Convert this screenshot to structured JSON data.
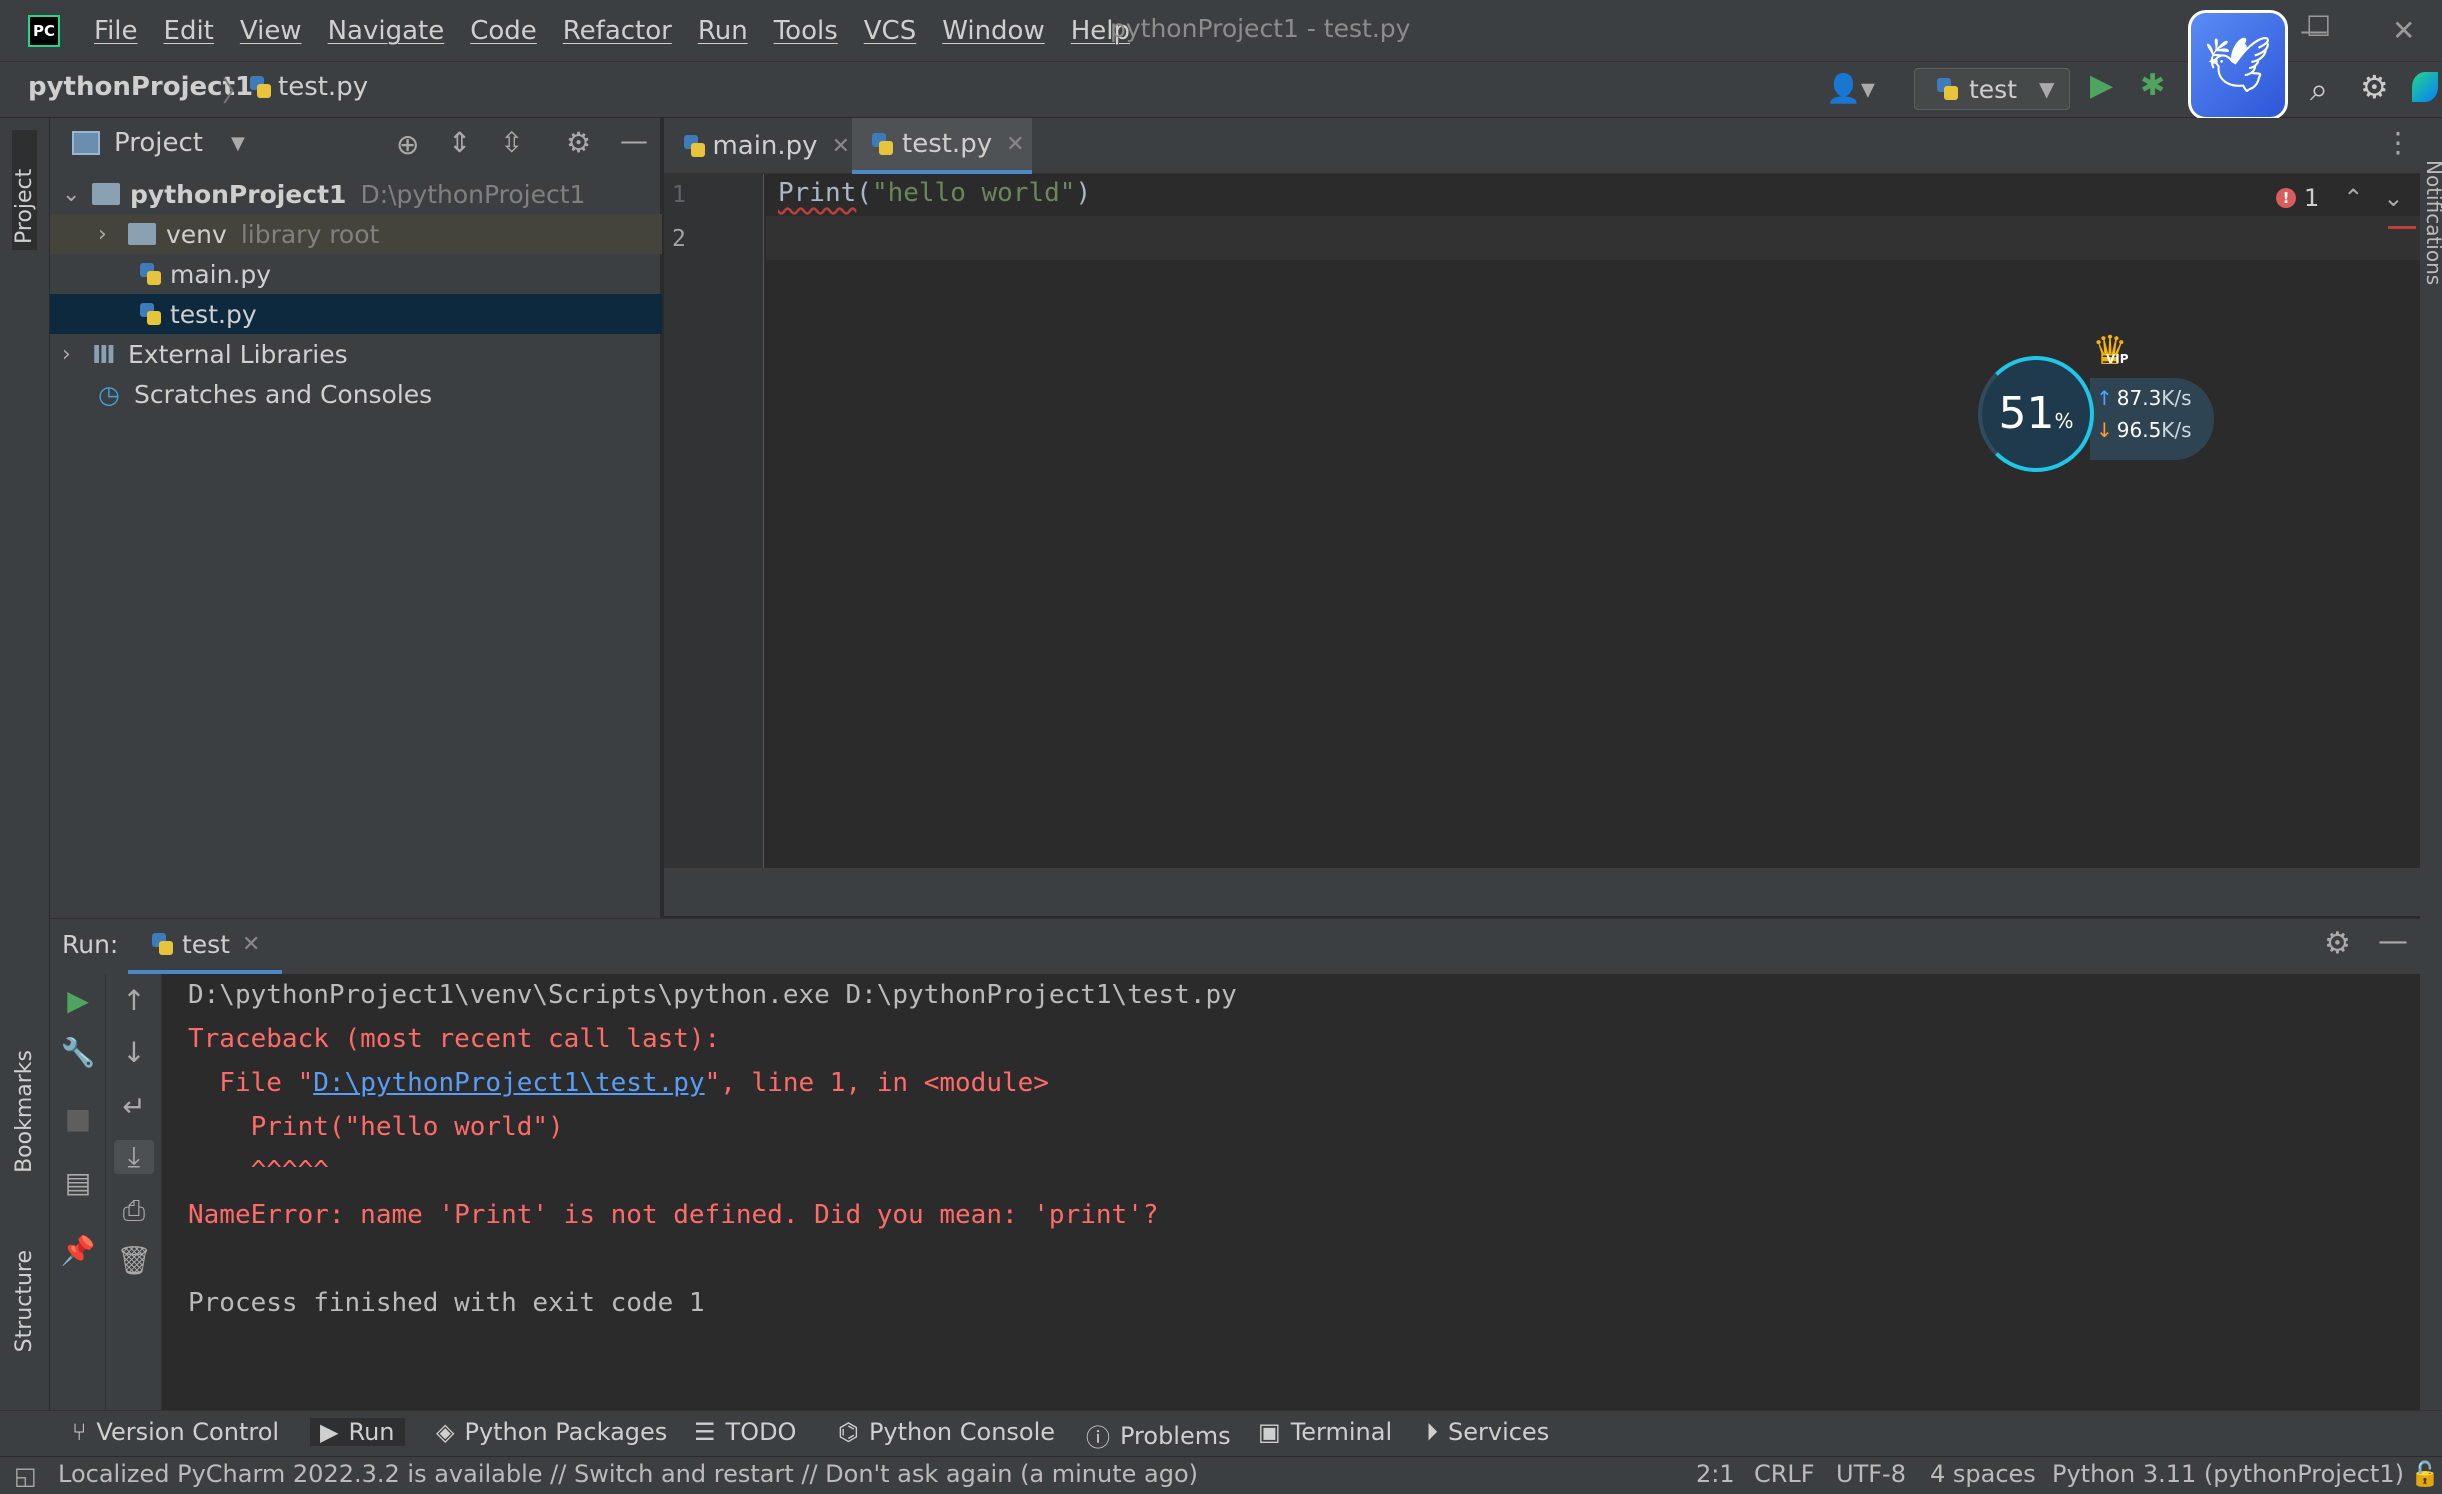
{
  "window": {
    "title": "pythonProject1 - test.py",
    "logo": "PC",
    "minimize": "—",
    "maximize": "☐",
    "close": "✕"
  },
  "menu": [
    "File",
    "Edit",
    "View",
    "Navigate",
    "Code",
    "Refactor",
    "Run",
    "Tools",
    "VCS",
    "Window",
    "Help"
  ],
  "breadcrumb": {
    "project": "pythonProject1",
    "separator": "〉",
    "file": "test.py"
  },
  "run_config": {
    "name": "test"
  },
  "side_tools": {
    "project": "Project",
    "bookmarks": "Bookmarks",
    "structure": "Structure",
    "notifications": "Notifications"
  },
  "project_panel": {
    "title": "Project",
    "tree": [
      {
        "label": "pythonProject1",
        "hint": "D:\\pythonProject1"
      },
      {
        "label": "venv",
        "hint": "library root"
      },
      {
        "label": "main.py",
        "hint": ""
      },
      {
        "label": "test.py",
        "hint": ""
      },
      {
        "label": "External Libraries",
        "hint": ""
      },
      {
        "label": "Scratches and Consoles",
        "hint": ""
      }
    ]
  },
  "editor": {
    "tabs": [
      {
        "label": "main.py"
      },
      {
        "label": "test.py"
      }
    ],
    "line_numbers": [
      "1",
      "2"
    ],
    "code": {
      "fn": "Print",
      "open": "(",
      "str": "\"hello world\"",
      "close": ")"
    },
    "error_count": "1"
  },
  "speed_widget": {
    "percent": "51",
    "percent_sign": "%",
    "upload": "87.3",
    "download": "96.5",
    "unit": "K/s",
    "badge": "VIP"
  },
  "run_panel": {
    "label": "Run:",
    "tab": "test",
    "console": [
      {
        "text": "D:\\pythonProject1\\venv\\Scripts\\python.exe D:\\pythonProject1\\test.py",
        "kind": "out"
      },
      {
        "text": "Traceback (most recent call last):",
        "kind": "err"
      },
      {
        "prefix": "  File \"",
        "link": "D:\\pythonProject1\\test.py",
        "suffix": "\", line 1, in <module>",
        "kind": "err"
      },
      {
        "text": "    Print(\"hello world\")",
        "kind": "err"
      },
      {
        "text": "    ^^^^^",
        "kind": "err"
      },
      {
        "text": "NameError: name 'Print' is not defined. Did you mean: 'print'?",
        "kind": "err"
      },
      {
        "text": "",
        "kind": "out"
      },
      {
        "text": "Process finished with exit code 1",
        "kind": "out"
      }
    ]
  },
  "bottom_tools": [
    "Version Control",
    "Run",
    "Python Packages",
    "TODO",
    "Python Console",
    "Problems",
    "Terminal",
    "Services"
  ],
  "status": {
    "message": "Localized PyCharm 2022.3.2 is available // Switch and restart // Don't ask again (a minute ago)",
    "position": "2:1",
    "line_ending": "CRLF",
    "encoding": "UTF-8",
    "indent": "4 spaces",
    "interpreter": "Python 3.11 (pythonProject1)"
  },
  "colors": {
    "accent": "#4a88c7",
    "error": "#ff6b68",
    "run_green": "#4ea55f",
    "background": "#2b2b2b",
    "panel": "#3c3f41"
  }
}
